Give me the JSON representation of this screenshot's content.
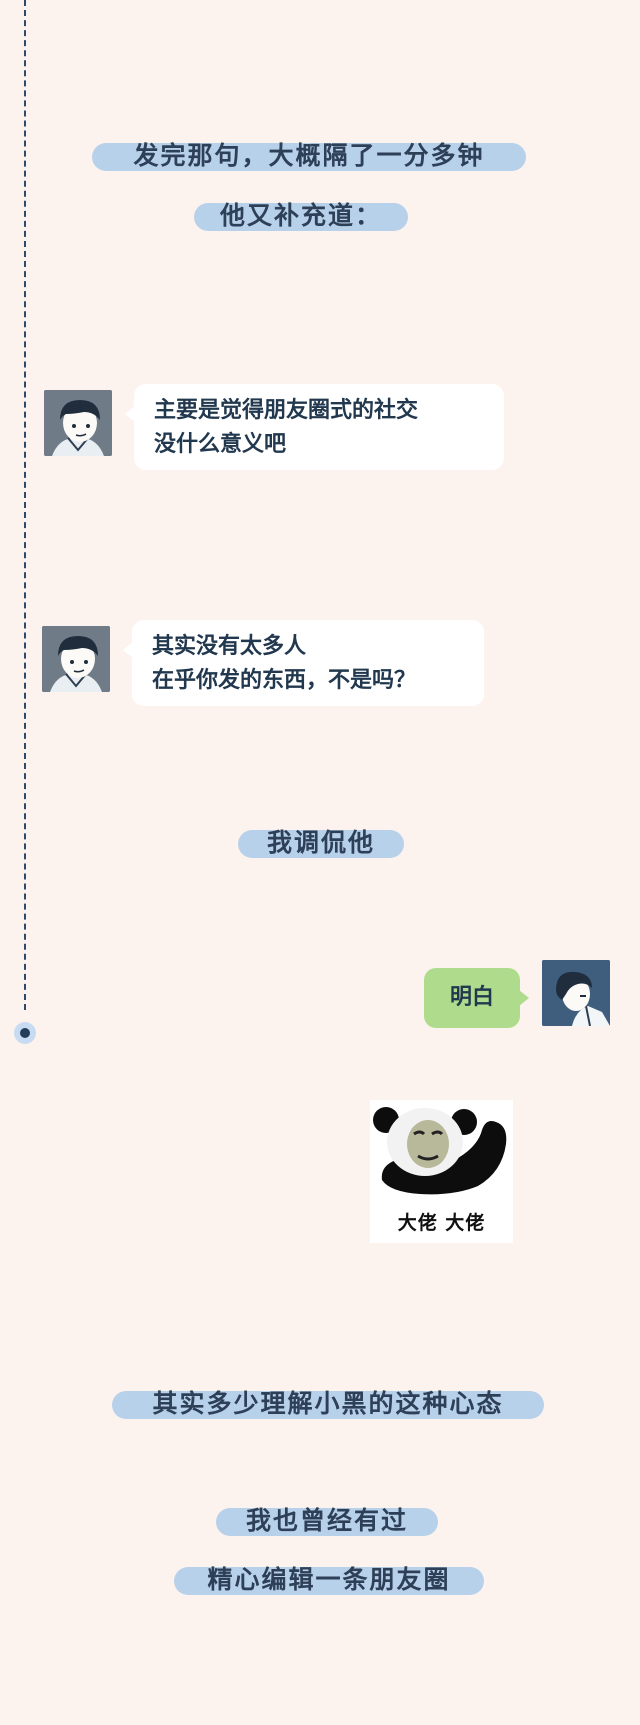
{
  "captions": {
    "c1": "发完那句，大概隔了一分多钟",
    "c2": "他又补充道：",
    "c3": "我调侃他",
    "c4": "其实多少理解小黑的这种心态",
    "c5": "我也曾经有过",
    "c6": "精心编辑一条朋友圈"
  },
  "messages": {
    "m1": {
      "line1": "主要是觉得朋友圈式的社交",
      "line2": "没什么意义吧"
    },
    "m2": {
      "line1": "其实没有太多人",
      "line2": "在乎你发的东西，不是吗？"
    },
    "reply": "明白"
  },
  "sticker": {
    "caption": "大佬  大佬"
  },
  "icons": {
    "friend_avatar": "man-avatar-icon",
    "my_avatar": "man-profile-avatar-icon",
    "sticker": "panda-meme-icon"
  },
  "colors": {
    "background": "#fdf3ee",
    "caption_pill": "#b8d1ea",
    "caption_text": "#2e4057",
    "incoming_bubble": "#ffffff",
    "outgoing_bubble": "#aedb8c",
    "timeline": "#2d4a6b"
  }
}
